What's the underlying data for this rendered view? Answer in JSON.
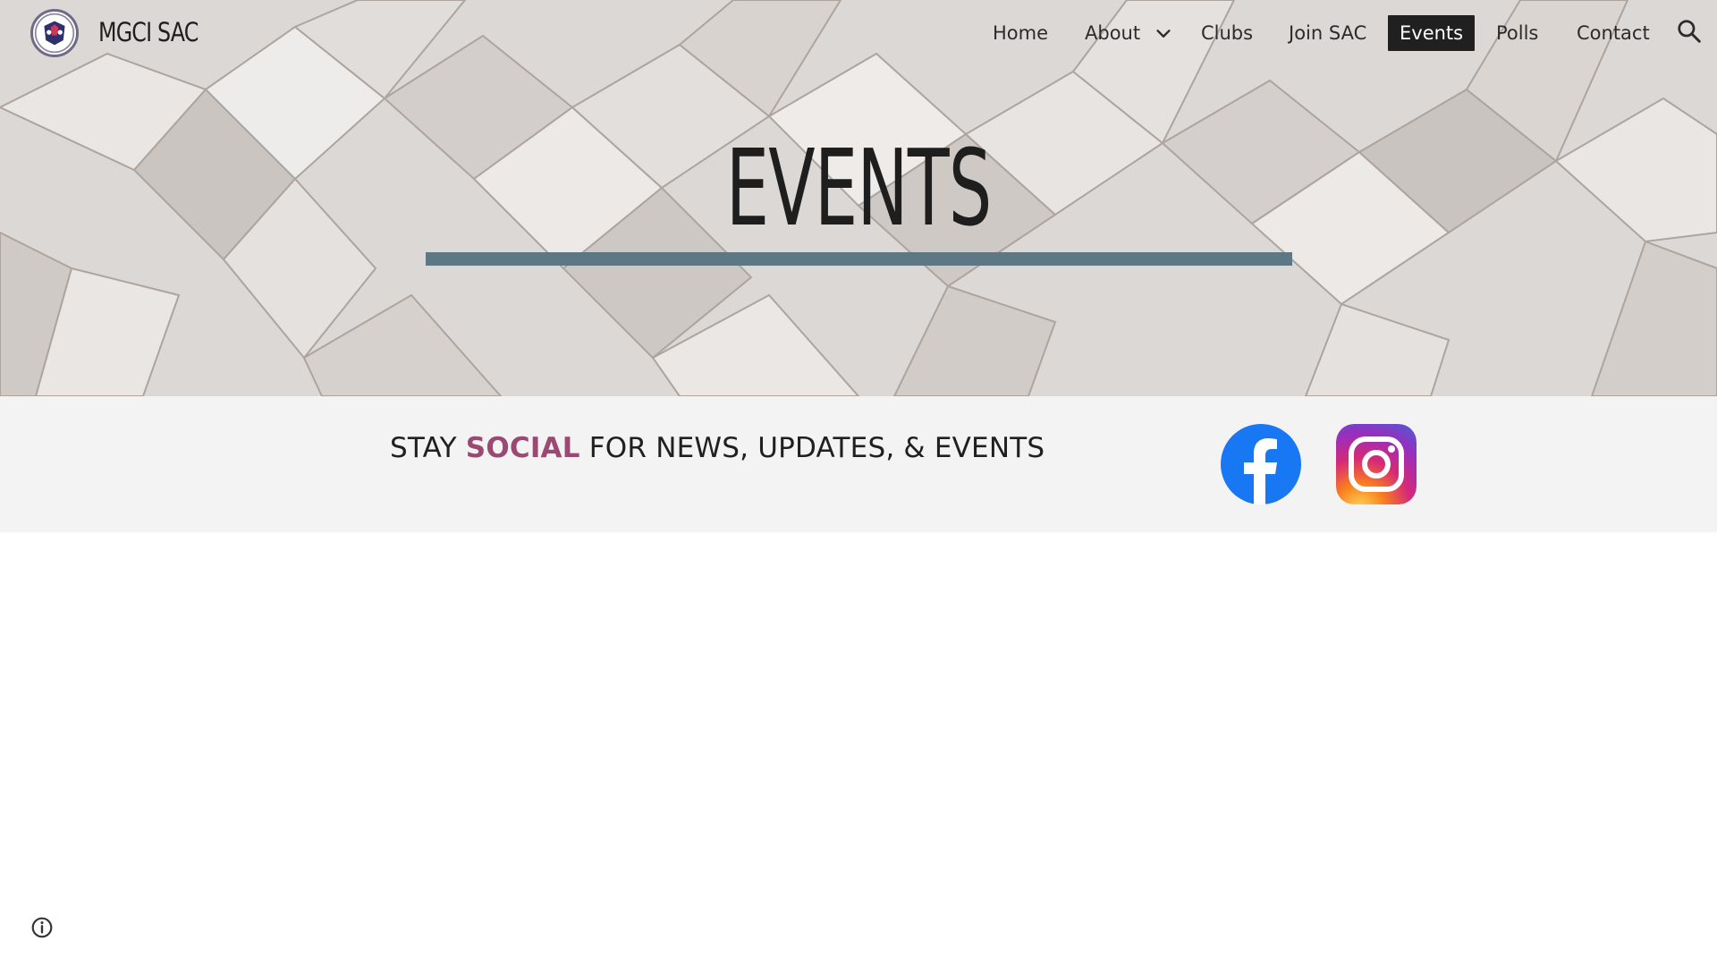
{
  "site": {
    "title": "MGCI SAC",
    "logo_icon": "school-crest-logo"
  },
  "nav": {
    "items": [
      {
        "label": "Home"
      },
      {
        "label": "About"
      },
      {
        "label": "Clubs"
      },
      {
        "label": "Join SAC"
      },
      {
        "label": "Events",
        "active": true
      },
      {
        "label": "Polls"
      },
      {
        "label": "Contact"
      }
    ],
    "about_dropdown_icon": "chevron-down-icon",
    "search_icon": "search-icon"
  },
  "hero": {
    "title": "EVENTS",
    "bar_color": "#5e7785"
  },
  "social": {
    "text_before": "STAY ",
    "text_accent": "SOCIAL",
    "text_after": " FOR NEWS, UPDATES, & EVENTS",
    "accent_color": "#9a4a72",
    "facebook_icon": "facebook-icon",
    "instagram_icon": "instagram-icon"
  },
  "footer": {
    "info_icon": "info-icon"
  }
}
